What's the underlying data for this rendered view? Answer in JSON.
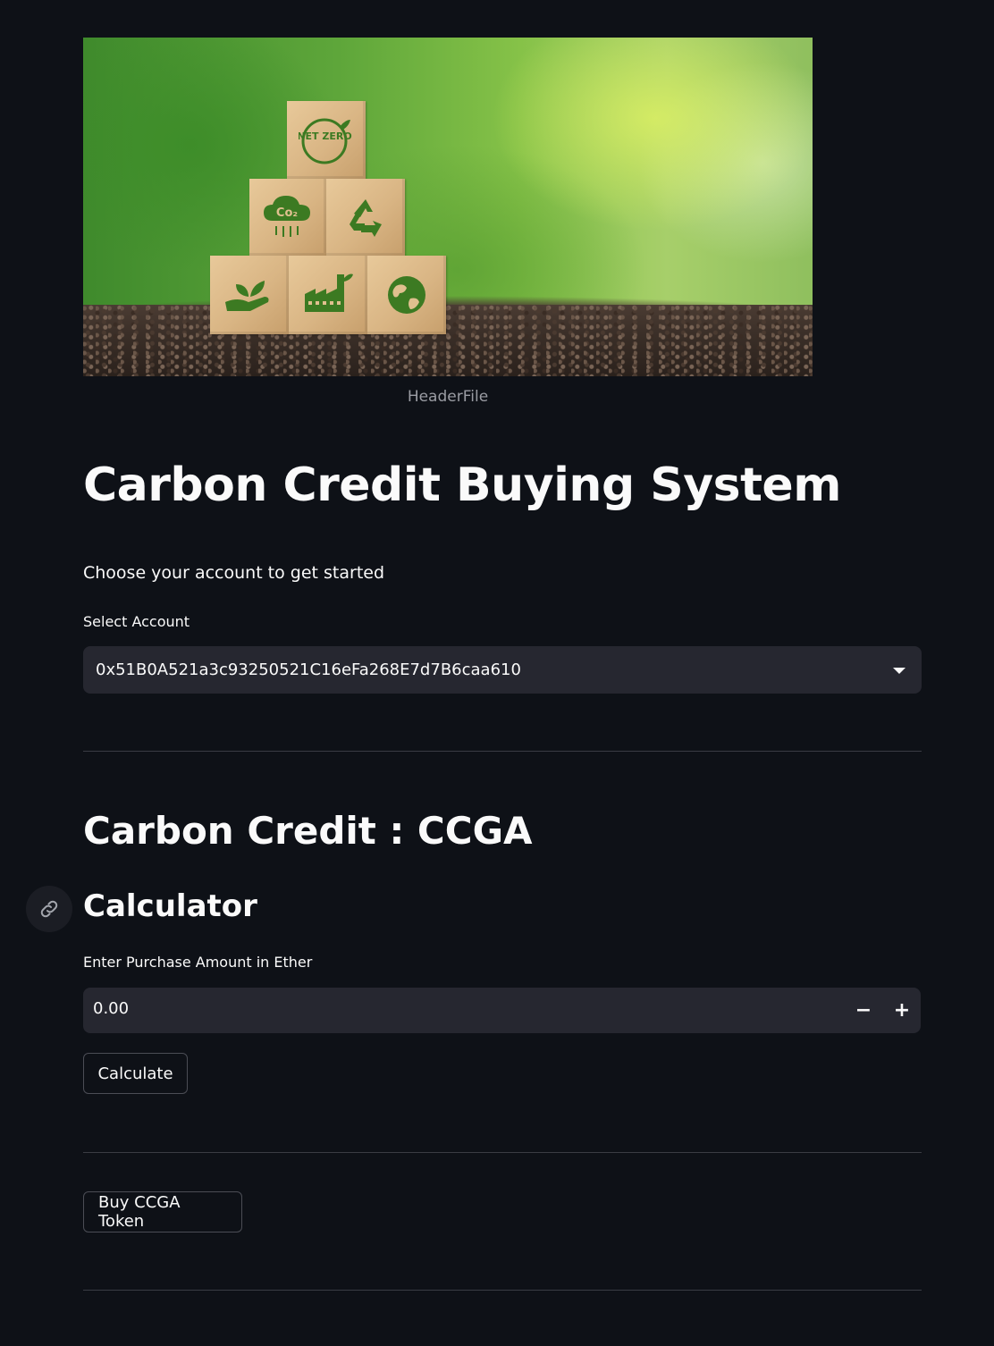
{
  "header_image": {
    "caption": "HeaderFile",
    "blocks": {
      "top": "NET ZERO",
      "co2": "Co₂"
    }
  },
  "title": "Carbon Credit Buying System",
  "intro_text": "Choose your account to get started",
  "account": {
    "label": "Select Account",
    "selected_value": "0x51B0A521a3c93250521C16eFa268E7d7B6caa610"
  },
  "token_section": {
    "heading": "Carbon Credit : CCGA"
  },
  "calculator": {
    "heading": "Calculator",
    "amount_label": "Enter Purchase Amount in Ether",
    "amount_value": "0.00",
    "decrement_label": "−",
    "increment_label": "+",
    "calculate_label": "Calculate"
  },
  "buy_button_label": "Buy CCGA Token"
}
